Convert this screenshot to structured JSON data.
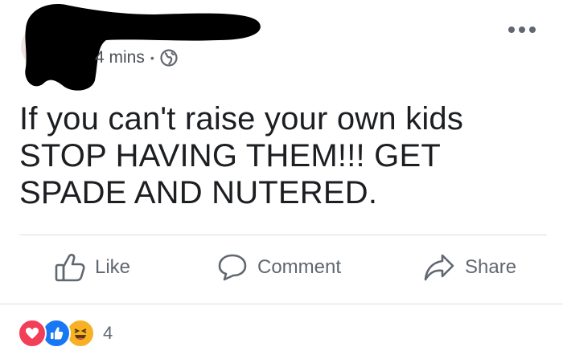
{
  "post": {
    "timestamp": "4 mins",
    "separator": "•",
    "privacy_icon": "globe-icon",
    "text": "If you can't raise your own kids\nSTOP HAVING THEM!!! GET\nSPADE AND NUTERED."
  },
  "actions": {
    "like_label": "Like",
    "comment_label": "Comment",
    "share_label": "Share"
  },
  "reactions": {
    "icons": [
      "love-icon",
      "like-icon",
      "haha-icon"
    ],
    "count": "4"
  },
  "colors": {
    "text": "#1c1e21",
    "secondary": "#606770",
    "love": "#f33e58",
    "like": "#1877f2",
    "haha": "#f7b125"
  }
}
